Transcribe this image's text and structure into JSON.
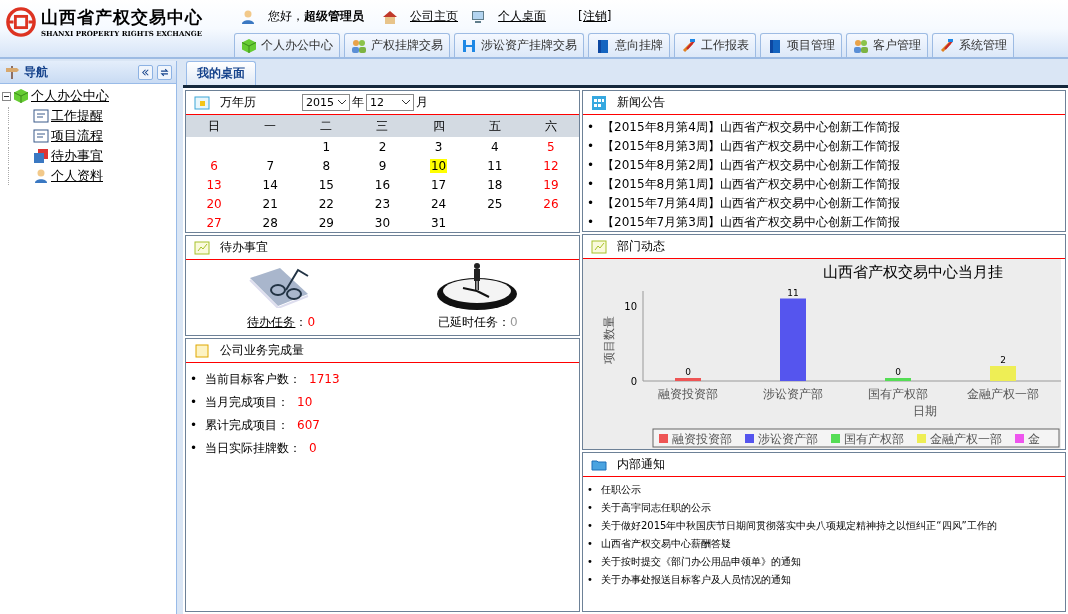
{
  "header": {
    "logo_title": "山西省产权交易中心",
    "logo_subtitle": "SHANXI PROPERTY RIGHTS EXCHANGE",
    "greeting": "您好，**超级管理员**",
    "links": [
      "公司主页",
      "个人桌面"
    ],
    "logout": "[注销]"
  },
  "main_tabs": [
    "个人办公中心",
    "产权挂牌交易",
    "涉讼资产挂牌交易",
    "意向挂牌",
    "工作报表",
    "项目管理",
    "客户管理",
    "系统管理"
  ],
  "sidebar": {
    "title": "导航",
    "tree": [
      {
        "label": "个人办公中心",
        "expanded": true,
        "children": [
          {
            "label": "工作提醒"
          },
          {
            "label": "项目流程"
          },
          {
            "label": "待办事宜"
          },
          {
            "label": "个人资料"
          }
        ]
      }
    ]
  },
  "content_tabs": [
    {
      "label": "我的桌面",
      "selected": true
    }
  ],
  "calendar": {
    "title": "万年历",
    "year": "2015",
    "year_label": "年",
    "month": "12",
    "month_label": "月",
    "weekdays": [
      "日",
      "一",
      "二",
      "三",
      "四",
      "五",
      "六"
    ],
    "weeks": [
      [
        {
          "day": "1",
          "today": false
        },
        {
          "day": "2",
          "today": false
        },
        {
          "day": "3",
          "today": false
        },
        {
          "day": "4",
          "today": false
        },
        {
          "day": "5",
          "today": false
        }
      ],
      [
        {
          "day": "6",
          "today": false
        },
        {
          "day": "7",
          "today": false
        },
        {
          "day": "8",
          "today": false
        },
        {
          "day": "9",
          "today": false
        },
        {
          "day": "10",
          "today": true
        },
        {
          "day": "11",
          "today": false
        },
        {
          "day": "12",
          "today": false
        }
      ],
      [
        {
          "day": "13",
          "today": false
        },
        {
          "day": "14",
          "today": false
        },
        {
          "day": "15",
          "today": false
        },
        {
          "day": "16",
          "today": false
        },
        {
          "day": "17",
          "today": false
        },
        {
          "day": "18",
          "today": false
        },
        {
          "day": "19",
          "today": false
        }
      ],
      [
        {
          "day": "20",
          "today": false
        },
        {
          "day": "21",
          "today": false
        },
        {
          "day": "22",
          "today": false
        },
        {
          "day": "23",
          "today": false
        },
        {
          "day": "24",
          "today": false
        },
        {
          "day": "25",
          "today": false
        },
        {
          "day": "26",
          "today": false
        }
      ],
      [
        {
          "day": "27",
          "today": false
        },
        {
          "day": "28",
          "today": false
        },
        {
          "day": "29",
          "today": false
        },
        {
          "day": "30",
          "today": false
        },
        {
          "day": "31",
          "today": false
        }
      ]
    ]
  },
  "todo": {
    "title": "待办事宜",
    "pending_label": "待办任务",
    "pending_separator": "：",
    "pending_value": "0",
    "delayed_label": "已延时任务：",
    "delayed_value": "0"
  },
  "stats": {
    "title": "公司业务完成量",
    "marker": "•",
    "items": [
      {
        "label": "当前目标客户数：",
        "value": "1713"
      },
      {
        "label": "当月完成项目：",
        "value": "10"
      },
      {
        "label": "累计完成项目：",
        "value": "607"
      },
      {
        "label": "当日实际挂牌数：",
        "value": "0"
      }
    ]
  },
  "news": {
    "title": "新闻公告",
    "marker": "•",
    "items": [
      "【2015年8月第4周】山西省产权交易中心创新工作简报",
      "【2015年8月第3周】山西省产权交易中心创新工作简报",
      "【2015年8月第2周】山西省产权交易中心创新工作简报",
      "【2015年8月第1周】山西省产权交易中心创新工作简报",
      "【2015年7月第4周】山西省产权交易中心创新工作简报",
      "【2015年7月第3周】山西省产权交易中心创新工作简报"
    ]
  },
  "department": {
    "title": "部门动态",
    "chart_data": {
      "type": "bar",
      "title": "山西省产权交易中心当月挂",
      "xlabel": "日期",
      "ylabel": "项目数量",
      "categories": [
        "融资投资部",
        "涉讼资产部",
        "国有产权部",
        "金融产权一部"
      ],
      "yticks": [
        0,
        10
      ],
      "ylim": [
        0,
        12
      ],
      "data_labels": true,
      "legend": "bottom",
      "series": [
        {
          "name": "融资投资部",
          "color": "#ee5555",
          "values": [
            0,
            null,
            null,
            null
          ]
        },
        {
          "name": "涉讼资产部",
          "color": "#5555ee",
          "values": [
            null,
            11,
            null,
            null
          ]
        },
        {
          "name": "国有产权部",
          "color": "#55dd55",
          "values": [
            null,
            null,
            0,
            null
          ]
        },
        {
          "name": "金融产权一部",
          "color": "#eeee55",
          "values": [
            null,
            null,
            null,
            2
          ]
        },
        {
          "name": "金",
          "color": "#ee55ee",
          "values": [
            null,
            null,
            null,
            null
          ]
        }
      ]
    }
  },
  "notices": {
    "title": "内部通知",
    "marker": "•",
    "items": [
      "任职公示",
      "关于高宇同志任职的公示",
      "关于做好2015年中秋国庆节日期间贯彻落实中央八项规定精神持之以恒纠正“四风”工作的",
      "山西省产权交易中心薪酬答疑",
      "关于按时提交《部门办公用品申领单》的通知",
      "关于办事处报送目标客户及人员情况的通知"
    ]
  }
}
